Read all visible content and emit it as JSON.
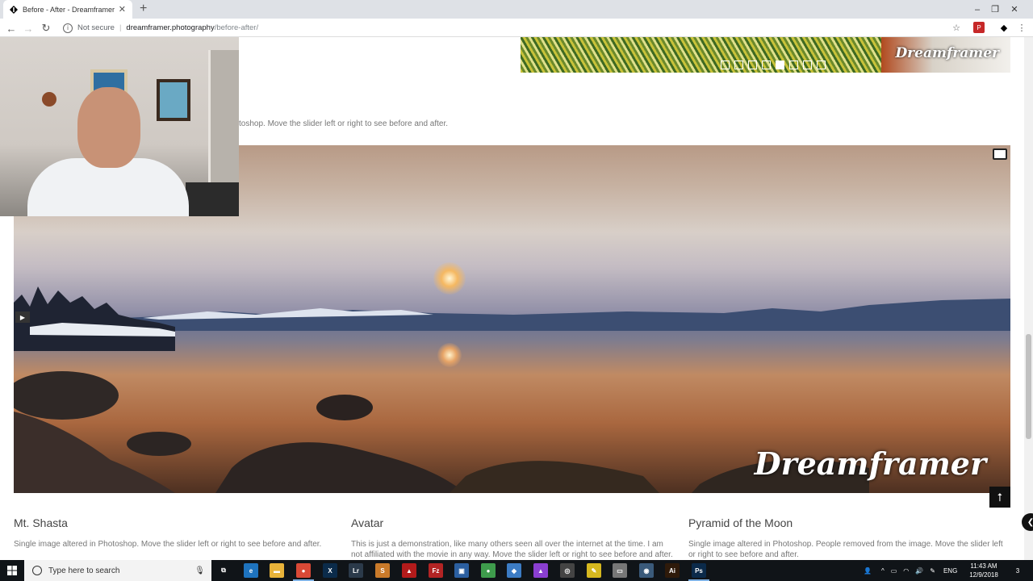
{
  "browser": {
    "tab_title": "Before - After - Dreamframer Art",
    "new_tab_label": "+",
    "url_security": "Not secure",
    "url_host": "dreamframer.photography",
    "url_path": "/before-after/",
    "window_controls": [
      "–",
      "❐",
      "✕"
    ]
  },
  "page": {
    "top_slider_logo": "Dreamframer",
    "top_slider_dot_count": 8,
    "top_slider_active_dot": 5,
    "desc_top": "toshop. Move the slider left or right to see before and after.",
    "hero_logo": "Dreamframer",
    "cards": [
      {
        "title": "Mt. Shasta",
        "text": "Single image altered in Photoshop. Move the slider left or right to see before and after."
      },
      {
        "title": "Avatar",
        "text": "This is just a demonstration, like many others seen all over the internet at the time. I am not affiliated with the movie in any way. Move the slider left or right to see before and after."
      },
      {
        "title": "Pyramid of the Moon",
        "text": "Single image altered in Photoshop. People removed from the image. Move the slider left or right to see before and after."
      }
    ]
  },
  "taskbar": {
    "search_placeholder": "Type here to search",
    "apps": [
      {
        "name": "task-view",
        "label": "⧉",
        "color": "#101418"
      },
      {
        "name": "edge",
        "label": "e",
        "color": "#1e73be"
      },
      {
        "name": "file-explorer",
        "label": "▬",
        "color": "#e8b33a"
      },
      {
        "name": "chrome",
        "label": "●",
        "color": "#d94936"
      },
      {
        "name": "x-app",
        "label": "X",
        "color": "#0b2b4a"
      },
      {
        "name": "lightroom",
        "label": "Lr",
        "color": "#2b3a4a"
      },
      {
        "name": "app-7",
        "label": "S",
        "color": "#c97a2a"
      },
      {
        "name": "app-8",
        "label": "▲",
        "color": "#b31b1b"
      },
      {
        "name": "filezilla",
        "label": "Fz",
        "color": "#b32424"
      },
      {
        "name": "app-10",
        "label": "▣",
        "color": "#2b5fa0"
      },
      {
        "name": "app-11",
        "label": "●",
        "color": "#3e9c4c"
      },
      {
        "name": "app-12",
        "label": "◆",
        "color": "#3c7cc4"
      },
      {
        "name": "app-13",
        "label": "▲",
        "color": "#8a3fd1"
      },
      {
        "name": "app-14",
        "label": "◎",
        "color": "#444444"
      },
      {
        "name": "app-15",
        "label": "✎",
        "color": "#d6b81f"
      },
      {
        "name": "camera",
        "label": "▭",
        "color": "#777777"
      },
      {
        "name": "app-17",
        "label": "◉",
        "color": "#3a5a7a"
      },
      {
        "name": "illustrator",
        "label": "Ai",
        "color": "#2e1a0a"
      },
      {
        "name": "photoshop",
        "label": "Ps",
        "color": "#0b2a4a"
      }
    ],
    "tray_lang": "ENG",
    "clock_time": "11:43 AM",
    "clock_date": "12/9/2018",
    "notification_count": "3"
  }
}
